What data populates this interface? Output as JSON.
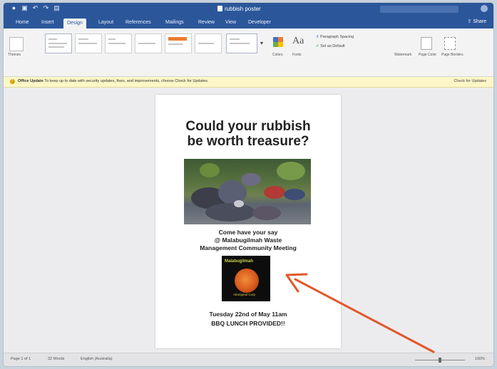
{
  "titlebar": {
    "document_title": "rubbish poster"
  },
  "tabs": [
    "Home",
    "Insert",
    "Design",
    "Layout",
    "References",
    "Mailings",
    "Review",
    "View",
    "Developer"
  ],
  "active_tab": "Design",
  "share_label": "Share",
  "ribbon": {
    "themes_label": "Themes",
    "colors_label": "Colors",
    "fonts_label": "Fonts",
    "paragraph_spacing": "Paragraph Spacing",
    "set_as_default": "Set as Default",
    "watermark": "Watermark",
    "page_color": "Page Color",
    "page_borders": "Page Borders"
  },
  "message_bar": {
    "label": "Office Update",
    "text": "To keep up to date with security updates, fixes, and improvements, choose Check for Updates.",
    "button": "Check for Updates"
  },
  "document": {
    "headline_line1": "Could your rubbish",
    "headline_line2": "be worth treasure?",
    "body_line1": "Come have your say",
    "body_line2": "@ Malabugilmah Waste",
    "body_line3": "Management Community Meeting",
    "date_line": "Tuesday 22nd of May 11am",
    "lunch_line": "BBQ LUNCH PROVIDED!!"
  },
  "statusbar": {
    "page": "Page 1 of 1",
    "words": "32 Words",
    "language": "English (Australia)",
    "zoom": "100%"
  },
  "colors": {
    "word_blue": "#2b579a",
    "arrow": "#e2572a",
    "message_bg": "#fdf6c7"
  }
}
